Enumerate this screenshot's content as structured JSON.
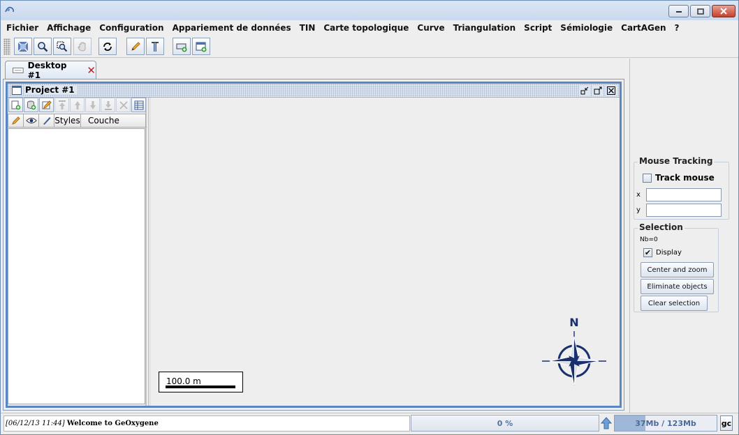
{
  "window": {
    "controls": [
      "minimize-icon",
      "maximize-icon",
      "close-icon"
    ]
  },
  "menu": [
    {
      "label": "Fichier"
    },
    {
      "label": "Affichage"
    },
    {
      "label": "Configuration"
    },
    {
      "label": "Appariement de données"
    },
    {
      "label": "TIN"
    },
    {
      "label": "Carte topologique"
    },
    {
      "label": "Curve"
    },
    {
      "label": "Triangulation"
    },
    {
      "label": "Script"
    },
    {
      "label": "Sémiologie"
    },
    {
      "label": "CartAGen"
    },
    {
      "label": "?"
    }
  ],
  "toolbar": {
    "buttons": [
      "zoom-extent-icon",
      "zoom-icon",
      "zoom-box-icon",
      "pan-icon",
      "refresh-icon",
      "edit-pencil-icon",
      "measure-icon",
      "add-layer-icon",
      "new-panel-icon"
    ]
  },
  "desktop_tab": {
    "label": "Desktop #1"
  },
  "project": {
    "title": "Project #1",
    "layer_columns": [
      "Styles",
      "Couche"
    ],
    "scale_label": "100.0 m",
    "north_label": "N"
  },
  "mouse_tracking": {
    "title": "Mouse Tracking",
    "track_label": "Track mouse",
    "track_checked": false,
    "x_label": "x",
    "y_label": "y",
    "x_value": "",
    "y_value": ""
  },
  "selection": {
    "title": "Selection",
    "count": "Nb=0",
    "display_label": "Display",
    "display_checked": true,
    "buttons": {
      "center_zoom": "Center and zoom",
      "eliminate": "Eliminate objects",
      "clear": "Clear selection"
    }
  },
  "status": {
    "timestamp": "[06/12/13 11:44]",
    "message": "Welcome to GeOxygene",
    "progress": "0 %",
    "memory": "37Mb / 123Mb",
    "memory_used_fraction": 0.3,
    "gc_label": "gc"
  },
  "colors": {
    "accent": "#5b86c4",
    "compass": "#1a2f6e",
    "tab_close": "#d01818"
  }
}
